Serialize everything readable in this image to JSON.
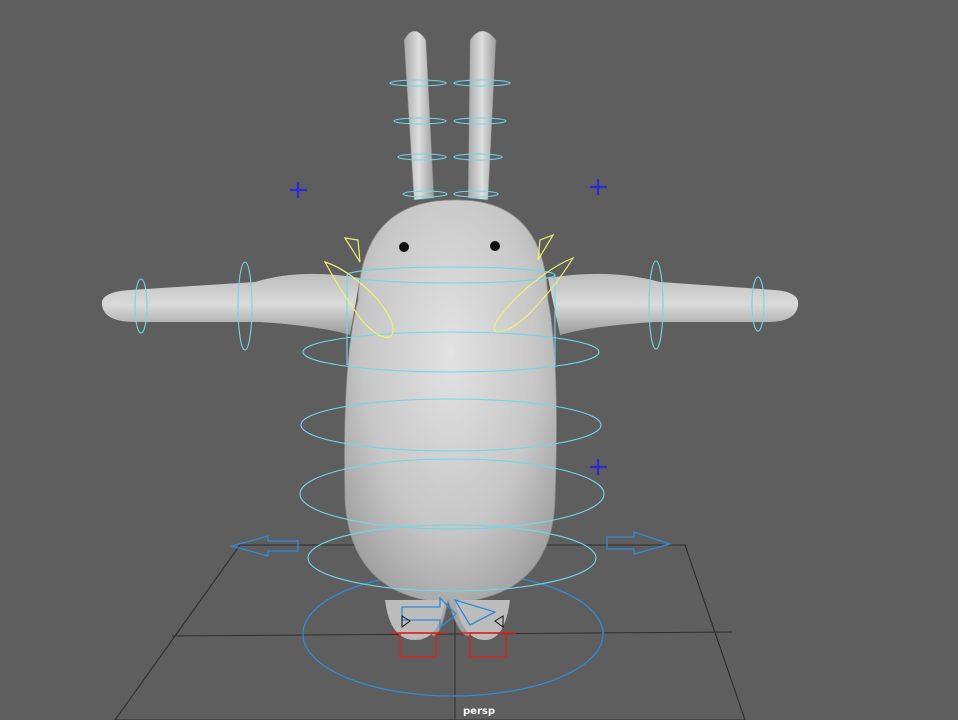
{
  "viewport": {
    "camera_label": "persp",
    "background_color": "#5e5e5e"
  },
  "colors": {
    "controls_cyan": "#6fd7ef",
    "controls_yellow": "#f0f070",
    "controls_blue": "#2f8ad8",
    "controls_red": "#e02020",
    "locator_blue": "#2b2bd8",
    "mesh_gray": "#cfcfcf"
  },
  "scene": {
    "model": "bunny-character",
    "icons": [
      "locator-cross-icon",
      "arrow-left-icon",
      "arrow-right-icon",
      "arrow-forward-icon"
    ]
  }
}
